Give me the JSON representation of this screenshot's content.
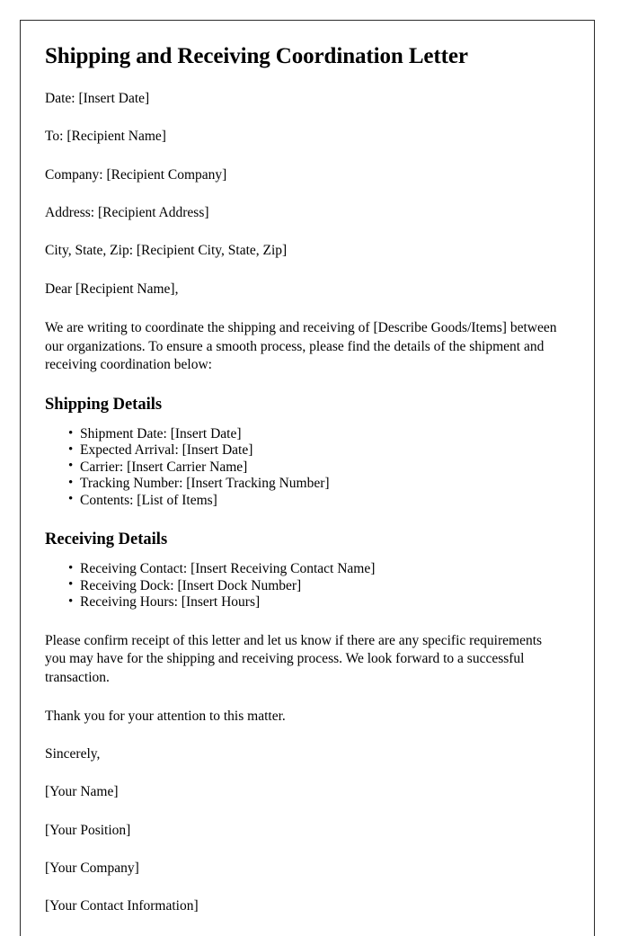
{
  "document": {
    "title": "Shipping and Receiving Coordination Letter",
    "header_fields": [
      "Date: [Insert Date]",
      "To: [Recipient Name]",
      "Company: [Recipient Company]",
      "Address: [Recipient Address]",
      "City, State, Zip: [Recipient City, State, Zip]"
    ],
    "salutation": "Dear [Recipient Name],",
    "intro_paragraph": "We are writing to coordinate the shipping and receiving of [Describe Goods/Items] between our organizations. To ensure a smooth process, please find the details of the shipment and receiving coordination below:",
    "shipping_section": {
      "heading": "Shipping Details",
      "items": [
        "Shipment Date: [Insert Date]",
        "Expected Arrival: [Insert Date]",
        "Carrier: [Insert Carrier Name]",
        "Tracking Number: [Insert Tracking Number]",
        "Contents: [List of Items]"
      ]
    },
    "receiving_section": {
      "heading": "Receiving Details",
      "items": [
        "Receiving Contact: [Insert Receiving Contact Name]",
        "Receiving Dock: [Insert Dock Number]",
        "Receiving Hours: [Insert Hours]"
      ]
    },
    "confirmation_paragraph": "Please confirm receipt of this letter and let us know if there are any specific requirements you may have for the shipping and receiving process. We look forward to a successful transaction.",
    "thank_you": "Thank you for your attention to this matter.",
    "sign_off": "Sincerely,",
    "signature_block": [
      "[Your Name]",
      "[Your Position]",
      "[Your Company]",
      "[Your Contact Information]"
    ]
  }
}
